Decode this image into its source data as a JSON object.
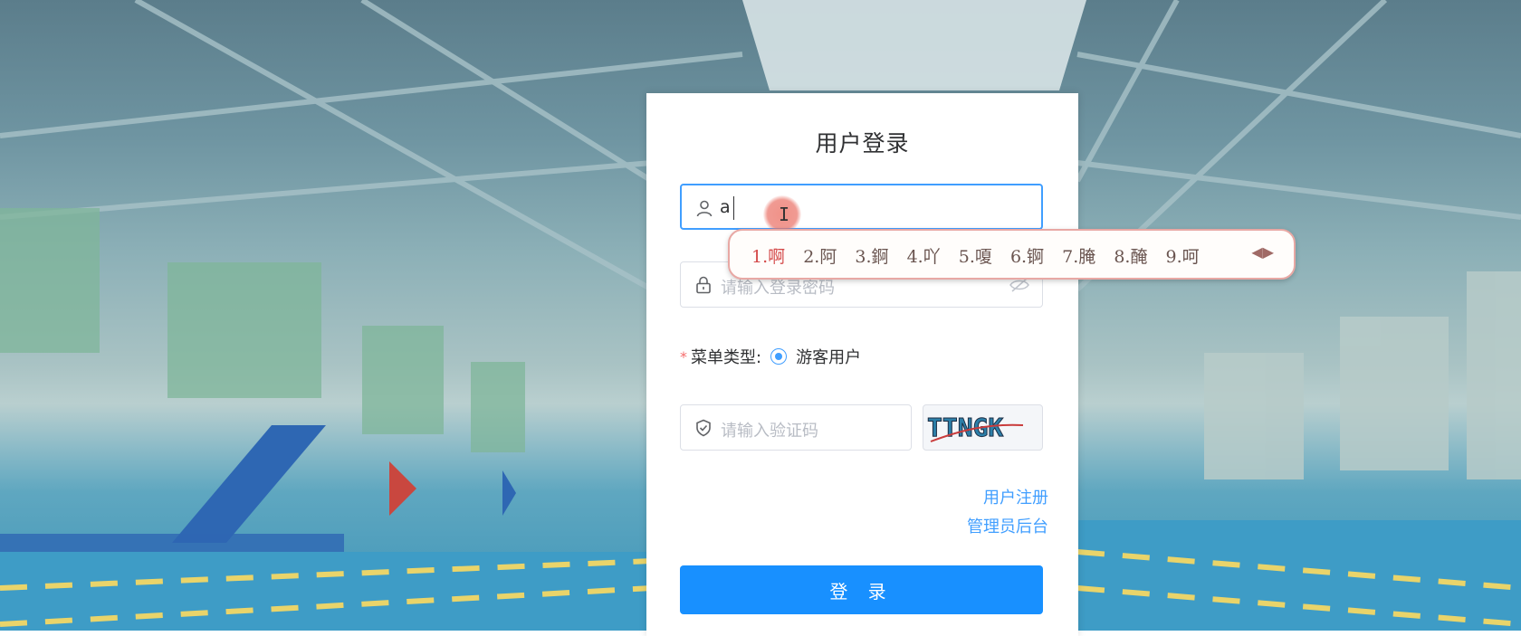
{
  "form": {
    "title": "用户登录",
    "username_value": "a",
    "password_placeholder": "请输入登录密码",
    "menu_type_label": "菜单类型:",
    "menu_type_option": "游客用户",
    "captcha_placeholder": "请输入验证码",
    "captcha_text": "TTNGK",
    "register_link": "用户注册",
    "admin_link": "管理员后台",
    "login_button": "登 录"
  },
  "ime": {
    "candidates": [
      "1.啊",
      "2.阿",
      "3.錒",
      "4.吖",
      "5.嗄",
      "6.锕",
      "7.腌",
      "8.醃",
      "9.呵"
    ],
    "nav": "◀▶"
  },
  "colors": {
    "accent": "#409eff",
    "button": "#1890ff",
    "required": "#f56c6c"
  },
  "icons": [
    "user-icon",
    "lock-icon",
    "eye-off-icon",
    "shield-check-icon",
    "ibeam-cursor-icon"
  ]
}
